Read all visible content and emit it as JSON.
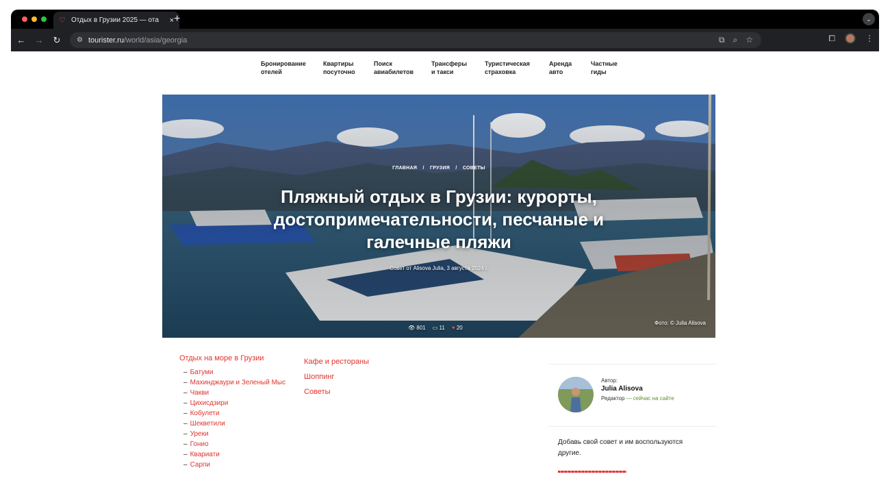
{
  "browser": {
    "tab_title": "Отдых в Грузии 2025 — ота",
    "tab_close": "×",
    "new_tab": "+",
    "url_host": "tourister.ru",
    "url_path": "/world/asia/georgia"
  },
  "nav": {
    "items": [
      {
        "label": "Бронирование\nотелей"
      },
      {
        "label": "Квартиры\nпосуточно"
      },
      {
        "label": "Поиск\nавиабилетов"
      },
      {
        "label": "Трансферы\nи такси"
      },
      {
        "label": "Туристическая\nстраховка"
      },
      {
        "label": "Аренда\nавто"
      },
      {
        "label": "Частные\nгиды"
      }
    ]
  },
  "hero": {
    "breadcrumbs": [
      "ГЛАВНАЯ",
      "ГРУЗИЯ",
      "СОВЕТЫ"
    ],
    "breadcrumb_sep": "/",
    "title": "Пляжный отдых в Грузии: курорты, достопримечательности, песчаные и галечные пляжи",
    "byline": "Совет от Alisova Julia, 3 августа 2024 г.",
    "views": "801",
    "comments": "11",
    "likes": "20",
    "photo_credit": "Фото: © Julia Alisova"
  },
  "content": {
    "section_title": "Отдых на море в Грузии",
    "resorts": [
      "Батуми",
      "Махинджаури и Зеленый Мыс",
      "Чакви",
      "Цихисдзири",
      "Кобулети",
      "Шекветили",
      "Уреки",
      "Гонио",
      "Квариати",
      "Сарпи"
    ],
    "other_links": [
      "Кафе и рестораны",
      "Шоппинг",
      "Советы"
    ]
  },
  "author": {
    "label": "Автор:",
    "name": "Julia Alisova",
    "role": "Редактор",
    "status": "— сейчас на сайте"
  },
  "cta": {
    "text": "Добавь свой совет и им воспользуются другие."
  },
  "colors": {
    "accent": "#e0332c",
    "online": "#5a8c2f"
  }
}
